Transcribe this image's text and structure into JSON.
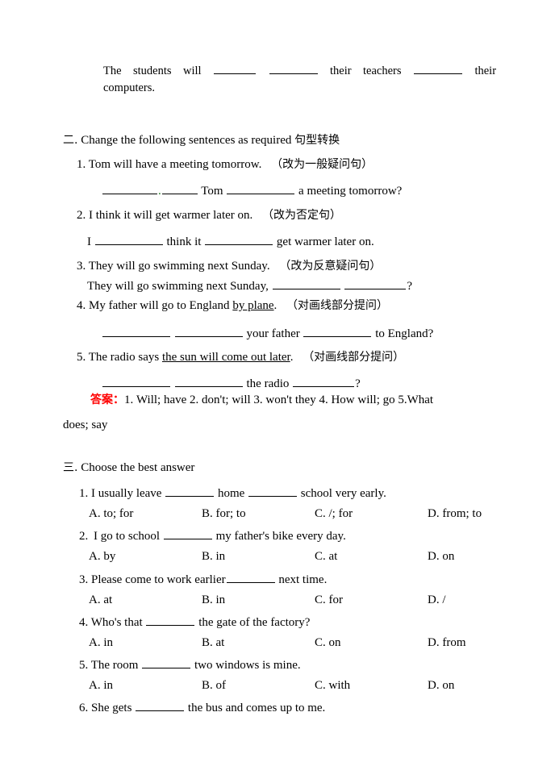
{
  "document": {
    "intro_paragraph": {
      "line1_part1": "The",
      "line1_part2": "students",
      "line1_part3": "will",
      "line1_part4": "their",
      "line1_part5": "teachers",
      "line1_part6": "their",
      "line2": "computers."
    },
    "section2": {
      "number": "二.",
      "title_en": "Change the following sentences as required",
      "title_cn": "句型转换",
      "questions": [
        {
          "num": "1.",
          "prompt": "Tom will have a meeting tomorrow.",
          "instruction": "（改为一般疑问句）",
          "answer_line_mid": "Tom",
          "answer_line_tail": "a meeting tomorrow?"
        },
        {
          "num": "2.",
          "prompt": "I think it will get warmer later on.",
          "instruction": "（改为否定句）",
          "answer_line_head": "I",
          "answer_line_mid": "think it",
          "answer_line_tail": "get warmer later on."
        },
        {
          "num": "3.",
          "prompt": "They will go swimming next Sunday.",
          "instruction": "（改为反意疑问句）",
          "answer_line_head": "They will go swimming next Sunday,",
          "answer_line_tail": "?"
        },
        {
          "num": "4.",
          "prompt_before": "My father will go to England",
          "prompt_underlined": "by plane",
          "prompt_after": ".",
          "instruction": "（对画线部分提问）",
          "answer_line_mid": "your father",
          "answer_line_tail": "to England?"
        },
        {
          "num": "5.",
          "prompt_before": "The radio says",
          "prompt_underlined": "the sun will come out later",
          "prompt_after": ".",
          "instruction": "（对画线部分提问）",
          "answer_line_mid": "the radio",
          "answer_line_tail": "?"
        }
      ],
      "answer_key": {
        "label": "答案：",
        "label_color": "#FF0000",
        "items_line1": "1. Will; have   2. don't; will   3. won't they   4. How will; go   5.What",
        "items_line2": "does; say"
      }
    },
    "section3": {
      "number": "三.",
      "title_en": "Choose the best answer",
      "questions": [
        {
          "num": "1.",
          "text_before": "I usually leave",
          "text_mid": "home",
          "text_after": "school very early.",
          "options": [
            "A. to; for",
            "B. for; to",
            "C. /; for",
            "D. from; to"
          ]
        },
        {
          "num": "2.",
          "text_before": "I go to school",
          "text_after": "my father's bike every day.",
          "options": [
            "A. by",
            "B. in",
            "C. at",
            "D. on"
          ]
        },
        {
          "num": "3.",
          "text_before": "Please come to work earlier",
          "text_after": "next time.",
          "options": [
            "A. at",
            "B. in",
            "C. for",
            "D. /"
          ]
        },
        {
          "num": "4.",
          "text_before": "Who's that",
          "text_after": "the gate of the factory?",
          "options": [
            "A. in",
            "B. at",
            "C. on",
            "D. from"
          ]
        },
        {
          "num": "5.",
          "text_before": "The room",
          "text_after": "two windows is mine.",
          "options": [
            "A. in",
            "B. of",
            "C. with",
            "D. on"
          ]
        },
        {
          "num": "6.",
          "text_before": "She gets",
          "text_after": "the bus and comes up to me.",
          "options": []
        }
      ]
    }
  }
}
